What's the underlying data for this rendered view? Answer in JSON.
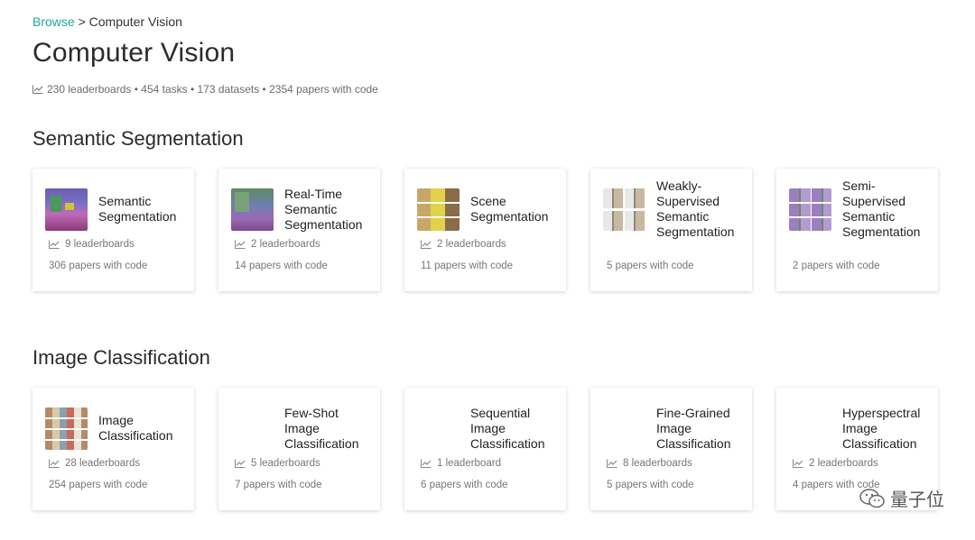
{
  "breadcrumb": {
    "root": "Browse",
    "separator": ">",
    "current": "Computer Vision"
  },
  "page": {
    "title": "Computer Vision",
    "stats": "230 leaderboards • 454 tasks • 173 datasets • 2354 papers with code"
  },
  "sections": [
    {
      "title": "Semantic Segmentation",
      "cards": [
        {
          "title": "Semantic Segmentation",
          "leaderboards": "9 leaderboards",
          "papers": "306 papers with code",
          "thumb": "t-seg"
        },
        {
          "title": "Real-Time Semantic Segmentation",
          "leaderboards": "2 leaderboards",
          "papers": "14 papers with code",
          "thumb": "t-rt"
        },
        {
          "title": "Scene Segmentation",
          "leaderboards": "2 leaderboards",
          "papers": "11 papers with code",
          "thumb": "t-scene"
        },
        {
          "title": "Weakly-Supervised Semantic Segmentation",
          "leaderboards": "",
          "papers": "5 papers with code",
          "thumb": "t-weak"
        },
        {
          "title": "Semi-Supervised Semantic Segmentation",
          "leaderboards": "",
          "papers": "2 papers with code",
          "thumb": "t-semi"
        }
      ]
    },
    {
      "title": "Image Classification",
      "cards": [
        {
          "title": "Image Classification",
          "leaderboards": "28 leaderboards",
          "papers": "254 papers with code",
          "thumb": "t-img"
        },
        {
          "title": "Few-Shot Image Classification",
          "leaderboards": "5 leaderboards",
          "papers": "7 papers with code",
          "thumb": "blank"
        },
        {
          "title": "Sequential Image Classification",
          "leaderboards": "1 leaderboard",
          "papers": "6 papers with code",
          "thumb": "blank"
        },
        {
          "title": "Fine-Grained Image Classification",
          "leaderboards": "8 leaderboards",
          "papers": "5 papers with code",
          "thumb": "blank"
        },
        {
          "title": "Hyperspectral Image Classification",
          "leaderboards": "2 leaderboards",
          "papers": "4 papers with code",
          "thumb": "blank"
        }
      ]
    }
  ],
  "watermark": {
    "text": "量子位"
  },
  "icons": {
    "stats": "line-chart-icon",
    "watermark": "wechat-logo-icon"
  },
  "colors": {
    "link": "#21a6a0",
    "text": "#222222",
    "muted": "#777777"
  }
}
